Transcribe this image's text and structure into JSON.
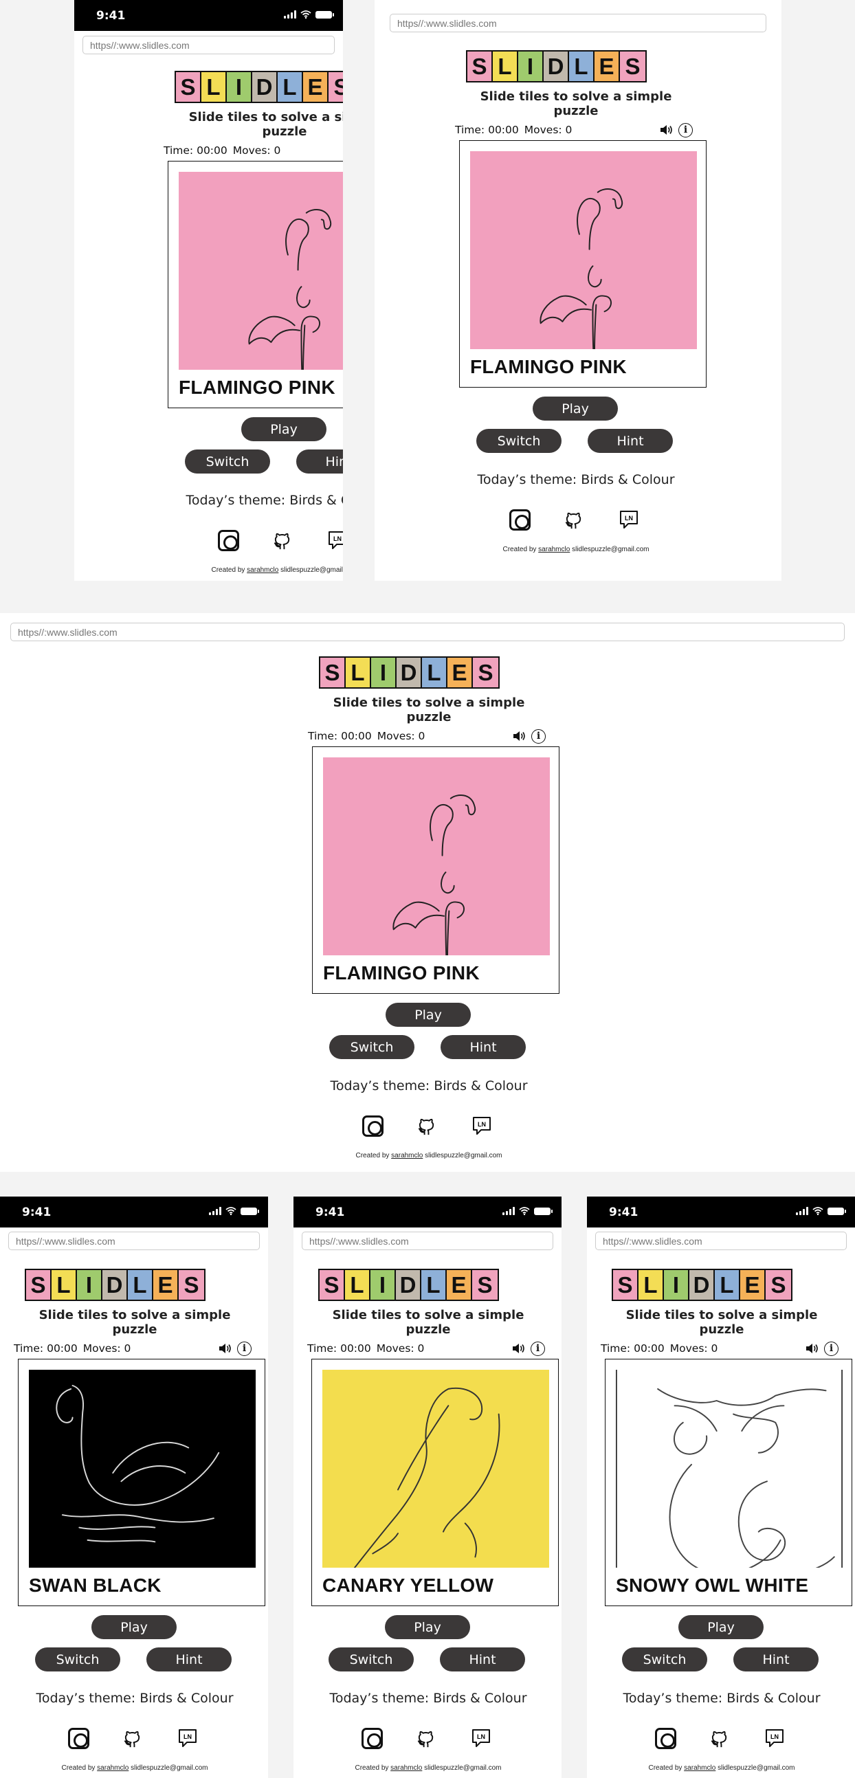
{
  "status": {
    "time": "9:41"
  },
  "browser": {
    "url": "https//:www.slidles.com"
  },
  "app": {
    "logo": [
      {
        "letter": "S",
        "color": "#f0a3bd"
      },
      {
        "letter": "L",
        "color": "#f3dd55"
      },
      {
        "letter": "I",
        "color": "#9fcb6d"
      },
      {
        "letter": "D",
        "color": "#c1b9ad"
      },
      {
        "letter": "L",
        "color": "#8eb0d8"
      },
      {
        "letter": "E",
        "color": "#f5b158"
      },
      {
        "letter": "S",
        "color": "#f0a3bd"
      }
    ],
    "tagline": "Slide tiles to solve a simple puzzle",
    "time_label": "Time: 00:00",
    "moves_label": "Moves: 0",
    "info_glyph": "i",
    "play_label": "Play",
    "switch_label": "Switch",
    "hint_label": "Hint",
    "theme": "Today’s theme: Birds & Colour",
    "credit_prefix": "Created by",
    "credit_user": "sarahmclo",
    "credit_email": "slidlespuzzle@gmail.com",
    "social": {
      "instagram": "instagram-icon",
      "github": "github-icon",
      "linkedin": "LN"
    }
  },
  "screens": [
    {
      "id": "mobile-flamingo",
      "puzzle_name": "FLAMINGO PINK",
      "art_color": "#f2a0be",
      "bird": "flamingo"
    },
    {
      "id": "tablet-flamingo",
      "puzzle_name": "FLAMINGO PINK",
      "art_color": "#f2a0be",
      "bird": "flamingo"
    },
    {
      "id": "desktop-flamingo",
      "puzzle_name": "FLAMINGO PINK",
      "art_color": "#f2a0be",
      "bird": "flamingo"
    },
    {
      "id": "mobile-swan",
      "puzzle_name": "SWAN BLACK",
      "art_color": "#000000",
      "bird": "swan"
    },
    {
      "id": "mobile-canary",
      "puzzle_name": "CANARY YELLOW",
      "art_color": "#f3dd4e",
      "bird": "canary"
    },
    {
      "id": "mobile-owl",
      "puzzle_name": "SNOWY OWL WHITE",
      "art_color": "#ffffff",
      "bird": "owl"
    }
  ]
}
